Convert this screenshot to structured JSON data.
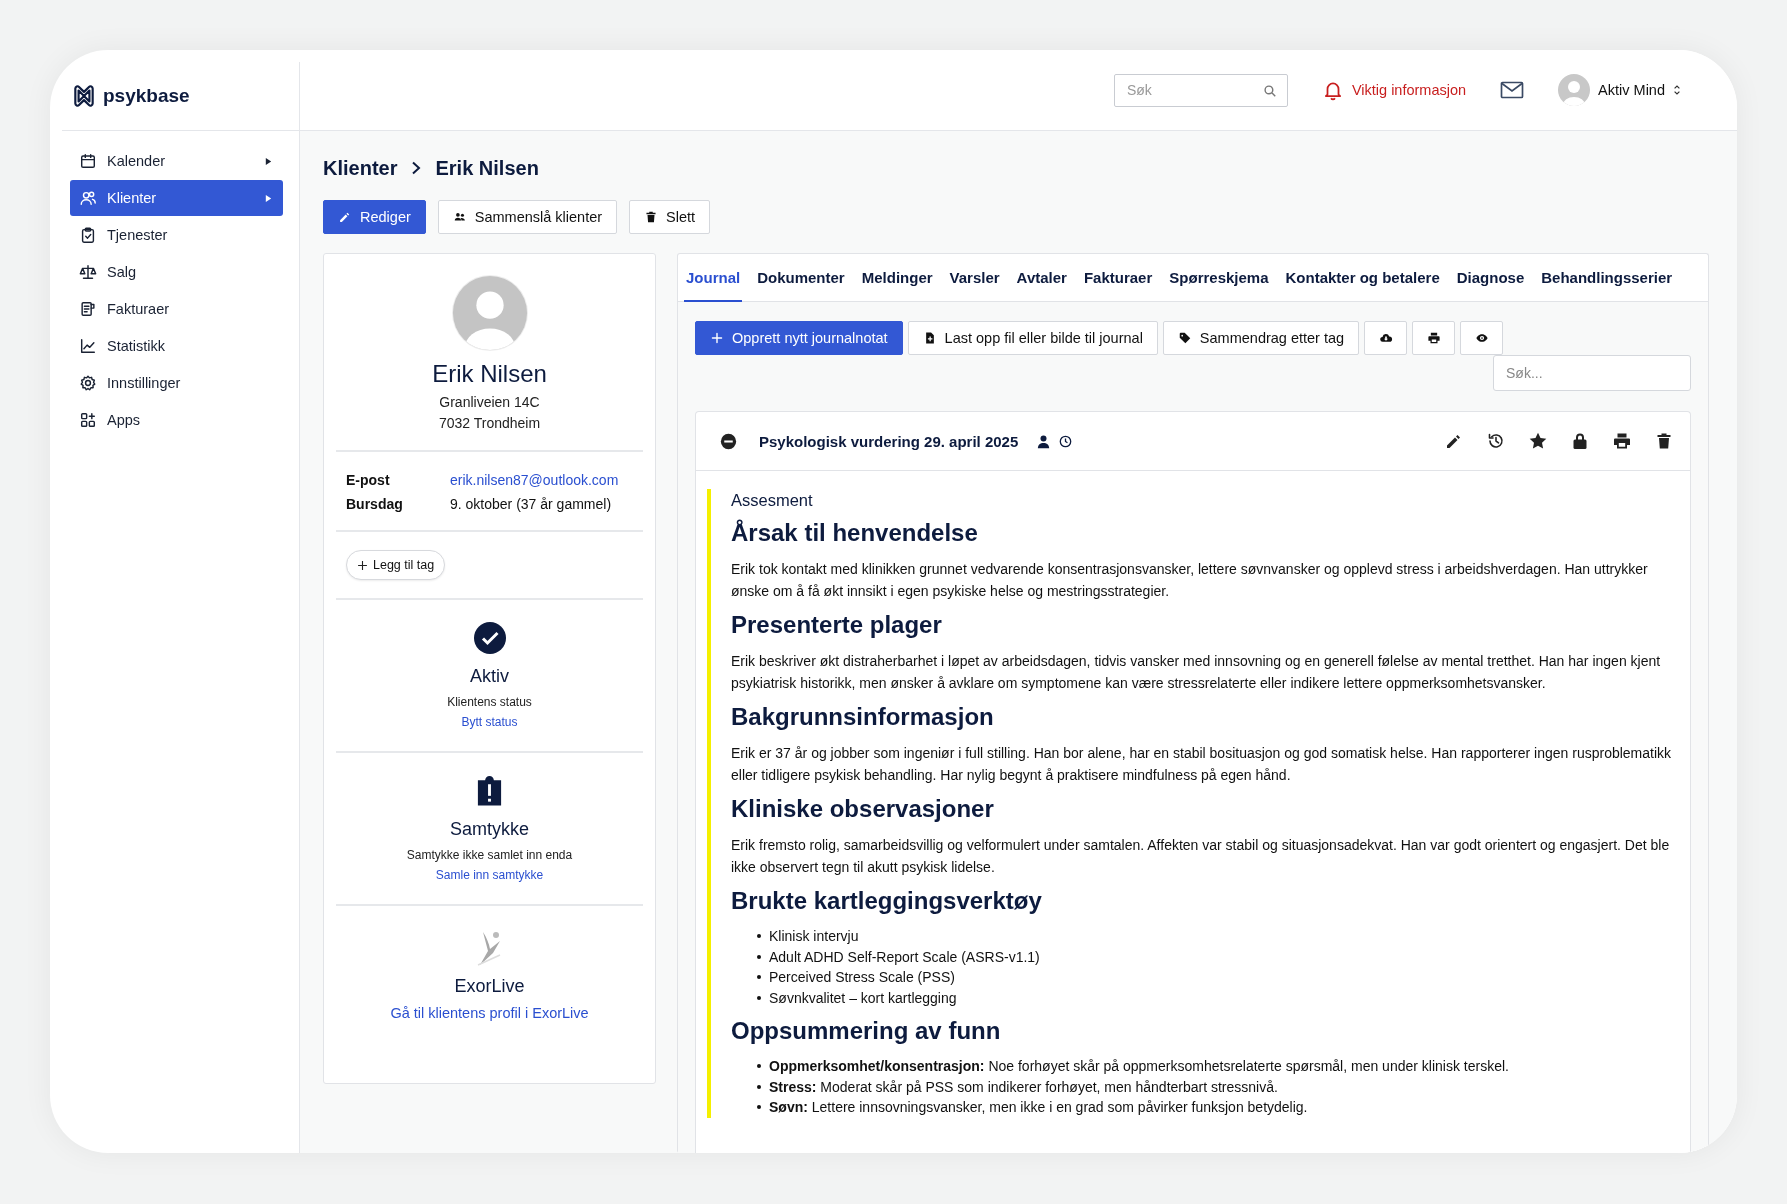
{
  "logo": {
    "name": "psykbase"
  },
  "topbar": {
    "search": {
      "placeholder": "Søk"
    },
    "alert": "Viktig informasjon",
    "user": {
      "name": "Aktiv Mind"
    }
  },
  "sidebar": {
    "items": [
      {
        "label": "Kalender",
        "expandable": true,
        "selected": false
      },
      {
        "label": "Klienter",
        "expandable": true,
        "selected": true
      },
      {
        "label": "Tjenester",
        "expandable": false,
        "selected": false
      },
      {
        "label": "Salg",
        "expandable": false,
        "selected": false
      },
      {
        "label": "Fakturaer",
        "expandable": false,
        "selected": false
      },
      {
        "label": "Statistikk",
        "expandable": false,
        "selected": false
      },
      {
        "label": "Innstillinger",
        "expandable": false,
        "selected": false
      },
      {
        "label": "Apps",
        "expandable": false,
        "selected": false
      }
    ]
  },
  "breadcrumb": [
    "Klienter",
    "Erik Nilsen"
  ],
  "actions": [
    {
      "label": "Rediger",
      "primary": true
    },
    {
      "label": "Sammenslå klienter",
      "primary": false
    },
    {
      "label": "Slett",
      "primary": false
    }
  ],
  "client": {
    "name": "Erik Nilsen",
    "address": [
      "Granliveien 14C",
      "7032 Trondheim"
    ],
    "details": [
      {
        "label": "E-post",
        "value": "erik.nilsen87@outlook.com",
        "link": true
      },
      {
        "label": "Bursdag",
        "value": "9. oktober (37 år gammel)",
        "link": false
      }
    ],
    "tag_button": "Legg til tag",
    "sections": [
      {
        "kind": "status",
        "title": "Aktiv",
        "subtitle": "Klientens status",
        "link": "Bytt status"
      },
      {
        "kind": "consent",
        "title": "Samtykke",
        "subtitle": "Samtykke ikke samlet inn enda",
        "link": "Samle inn samtykke"
      },
      {
        "kind": "integration",
        "title": "ExorLive",
        "link": "Gå til klientens profil i ExorLive"
      }
    ]
  },
  "tabs": [
    {
      "label": "Journal",
      "selected": true
    },
    {
      "label": "Dokumenter",
      "selected": false
    },
    {
      "label": "Meldinger",
      "selected": false
    },
    {
      "label": "Varsler",
      "selected": false
    },
    {
      "label": "Avtaler",
      "selected": false
    },
    {
      "label": "Fakturaer",
      "selected": false
    },
    {
      "label": "Spørreskjema",
      "selected": false
    },
    {
      "label": "Kontakter og betalere",
      "selected": false
    },
    {
      "label": "Diagnose",
      "selected": false
    },
    {
      "label": "Behandlingsserier",
      "selected": false
    }
  ],
  "journal_toolbar": {
    "buttons": [
      {
        "label": "Opprett nytt journalnotat",
        "primary": true
      },
      {
        "label": "Last opp fil eller bilde til journal",
        "primary": false
      },
      {
        "label": "Sammendrag etter tag",
        "primary": false
      },
      {
        "primary": false
      },
      {
        "primary": false
      },
      {
        "primary": false
      }
    ],
    "search": {
      "placeholder": "Søk..."
    }
  },
  "entry": {
    "title": "Psykologisk vurdering 29. april 2025",
    "expanded": true,
    "type": "Assesment",
    "sections": [
      {
        "kind": "paragraph",
        "heading": "Årsak til henvendelse",
        "text": "Erik tok kontakt med klinikken grunnet vedvarende konsentrasjonsvansker, lettere søvnvansker og opplevd stress i arbeidshverdagen. Han uttrykker ønske om å få økt innsikt i egen psykiske helse og mestringsstrategier."
      },
      {
        "kind": "paragraph",
        "heading": "Presenterte plager",
        "text": "Erik beskriver økt distraherbarhet i løpet av arbeidsdagen, tidvis vansker med innsovning og en generell følelse av mental tretthet. Han har ingen kjent psykiatrisk historikk, men ønsker å avklare om symptomene kan være stressrelaterte eller indikere lettere oppmerksomhetsvansker."
      },
      {
        "kind": "paragraph",
        "heading": "Bakgrunnsinformasjon",
        "text": "Erik er 37 år og jobber som ingeniør i full stilling. Han bor alene, har en stabil bosituasjon og god somatisk helse. Han rapporterer ingen rusproblematikk eller tidligere psykisk behandling. Har nylig begynt å praktisere mindfulness på egen hånd."
      },
      {
        "kind": "paragraph",
        "heading": "Kliniske observasjoner",
        "text": "Erik fremsto rolig, samarbeidsvillig og velformulert under samtalen. Affekten var stabil og situasjonsadekvat. Han var godt orientert og engasjert. Det ble ikke observert tegn til akutt psykisk lidelse."
      },
      {
        "kind": "list",
        "heading": "Brukte kartleggingsverktøy",
        "items": [
          "Klinisk intervju",
          "Adult ADHD Self-Report Scale (ASRS-v1.1)",
          "Perceived Stress Scale (PSS)",
          "Søvnkvalitet – kort kartlegging"
        ]
      },
      {
        "kind": "list",
        "heading": "Oppsummering av funn",
        "items": [
          "**Oppmerksomhet/konsentrasjon:** Noe forhøyet skår på oppmerksomhetsrelaterte spørsmål, men under klinisk terskel.",
          "**Stress:** Moderat skår på PSS som indikerer forhøyet, men håndterbart stressnivå.",
          "**Søvn:** Lettere innsovningsvansker, men ikke i en grad som påvirker funksjon betydelig."
        ]
      }
    ]
  }
}
